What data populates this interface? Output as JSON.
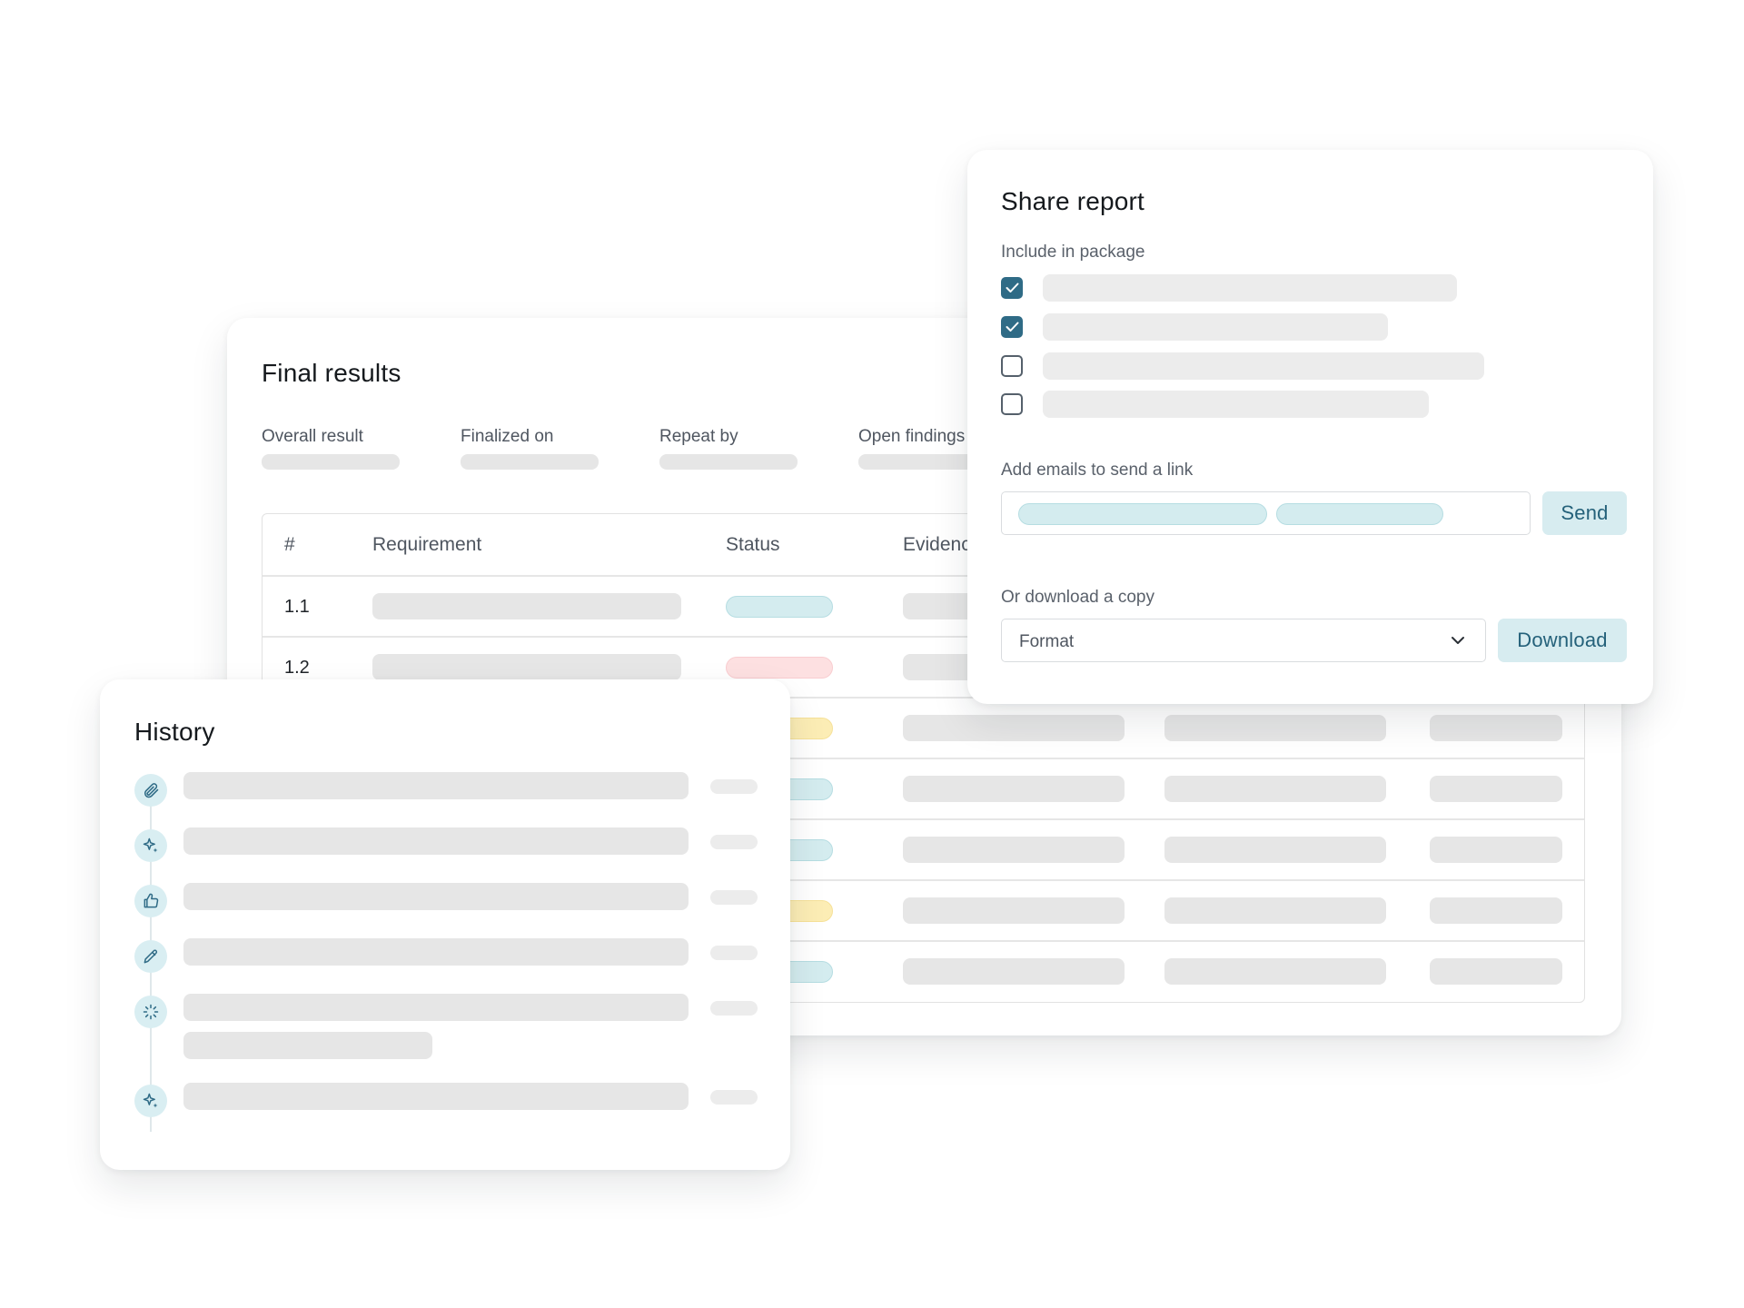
{
  "final_results": {
    "title": "Final results",
    "meta": [
      {
        "label": "Overall result"
      },
      {
        "label": "Finalized on"
      },
      {
        "label": "Repeat by"
      },
      {
        "label": "Open findings"
      }
    ],
    "table": {
      "headers": [
        "#",
        "Requirement",
        "Status",
        "Evidence"
      ],
      "rows": [
        {
          "id": "1.1",
          "status": "teal"
        },
        {
          "id": "1.2",
          "status": "red"
        },
        {
          "id": "",
          "status": "yellow"
        },
        {
          "id": "",
          "status": "teal"
        },
        {
          "id": "",
          "status": "teal"
        },
        {
          "id": "",
          "status": "yellow"
        },
        {
          "id": "",
          "status": "teal"
        }
      ]
    }
  },
  "share_report": {
    "title": "Share report",
    "include_label": "Include in package",
    "checkboxes": [
      {
        "checked": true
      },
      {
        "checked": true
      },
      {
        "checked": false
      },
      {
        "checked": false
      }
    ],
    "emails_label": "Add emails to send a link",
    "send_label": "Send",
    "download_copy_label": "Or download a copy",
    "format_placeholder": "Format",
    "download_label": "Download"
  },
  "history": {
    "title": "History",
    "items": [
      {
        "icon": "paperclip-icon"
      },
      {
        "icon": "sparkle-icon"
      },
      {
        "icon": "thumbs-up-icon"
      },
      {
        "icon": "pencil-icon"
      },
      {
        "icon": "loader-icon"
      },
      {
        "icon": "sparkle-icon"
      }
    ]
  },
  "colors": {
    "accent": "#2f6b86",
    "button_bg": "#d7ecf0",
    "button_text": "#24617a",
    "status_teal": "#d4ecef",
    "status_red": "#fde0e1",
    "status_yellow": "#fcedb5",
    "skeleton": "#e6e6e6"
  }
}
